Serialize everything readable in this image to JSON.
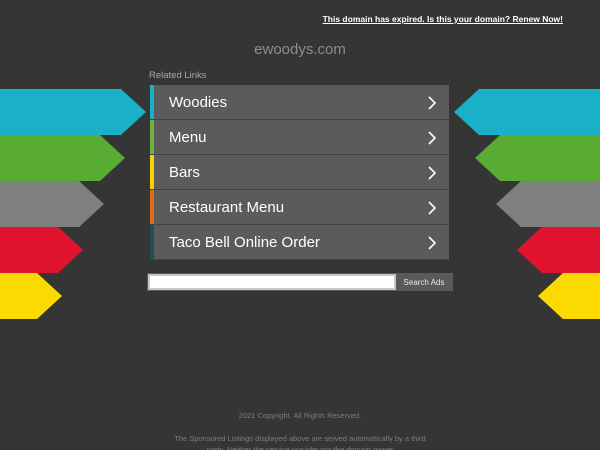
{
  "header": {
    "expired_notice": "This domain has expired. Is this your domain? Renew Now!",
    "domain": "ewoodys.com"
  },
  "related_links": {
    "heading": "Related Links",
    "items": [
      {
        "label": "Woodies",
        "color": "#1ab0c8"
      },
      {
        "label": "Menu",
        "color": "#6fb43f"
      },
      {
        "label": "Bars",
        "color": "#f5d20a"
      },
      {
        "label": "Restaurant Menu",
        "color": "#e06a1e"
      },
      {
        "label": "Taco Bell Online Order",
        "color": "#1d4e5a"
      }
    ]
  },
  "search": {
    "placeholder": "",
    "button_label": "Search Ads"
  },
  "footer": {
    "copyright": "2021 Copyright. All Rights Reserved.",
    "disclaimer": "The Sponsored Listings displayed above are served automatically by a third party. Neither the service provider nor the domain owner"
  },
  "colors": {
    "background": "#353535",
    "arrow_cyan": "#1ab0c8",
    "arrow_green": "#58ab33",
    "arrow_gray": "#808080",
    "arrow_red": "#e0142e",
    "arrow_yellow": "#fcd900"
  }
}
